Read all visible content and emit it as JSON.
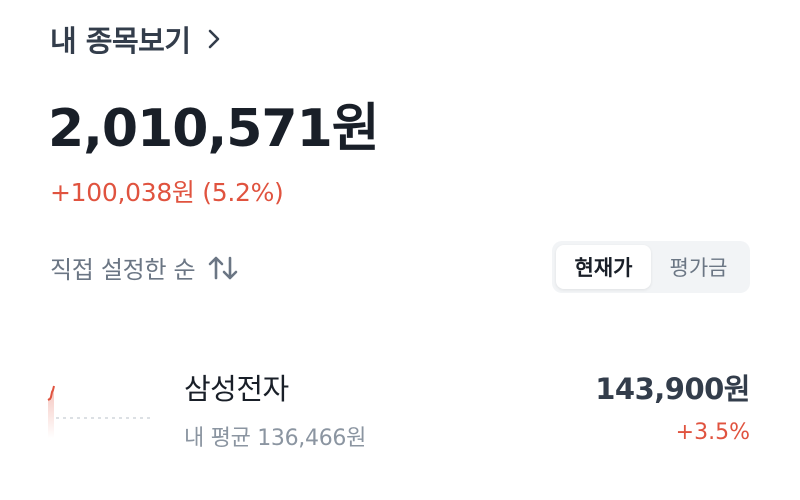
{
  "header": {
    "title": "내 종목보기",
    "icon": "chevron-right-icon"
  },
  "summary": {
    "total_value": "2,010,571원",
    "change": "+100,038원 (5.2%)",
    "change_color": "#e0533f"
  },
  "sort": {
    "label": "직접 설정한 순",
    "icon": "sort-arrows-icon"
  },
  "view_toggle": {
    "options": [
      "현재가",
      "평가금"
    ],
    "selected": "현재가"
  },
  "stocks": [
    {
      "name": "삼성전자",
      "avg_price": "내 평균 136,466원",
      "price": "143,900원",
      "rate": "+3.5%",
      "rate_color": "#e0533f"
    }
  ]
}
